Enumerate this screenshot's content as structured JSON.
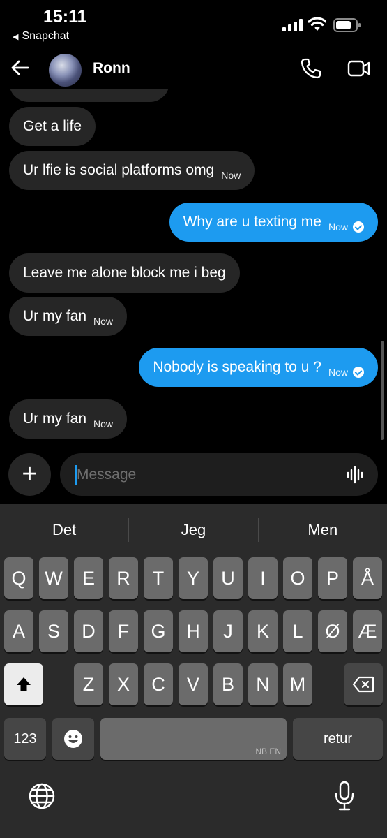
{
  "status_bar": {
    "time": "15:11",
    "back_app": "Snapchat"
  },
  "header": {
    "name": "Ronn",
    "icons": [
      "back-arrow-icon",
      "phone-icon",
      "video-camera-icon"
    ]
  },
  "messages": [
    {
      "side": "in",
      "text": "Get a life",
      "time": ""
    },
    {
      "side": "in",
      "text": "Ur lfie is social platforms omg",
      "time": "Now"
    },
    {
      "side": "out",
      "text": "Why are u texting me",
      "time": "Now"
    },
    {
      "side": "in",
      "text": "Leave me alone block me i beg",
      "time": ""
    },
    {
      "side": "in",
      "text": "Ur my fan",
      "time": "Now"
    },
    {
      "side": "out",
      "text": "Nobody is speaking to u ?",
      "time": "Now"
    },
    {
      "side": "in",
      "text": "Ur my fan",
      "time": "Now"
    }
  ],
  "composer": {
    "placeholder": "Message",
    "plus": "+"
  },
  "keyboard": {
    "suggestions": [
      "Det",
      "Jeg",
      "Men"
    ],
    "row1": [
      "Q",
      "W",
      "E",
      "R",
      "T",
      "Y",
      "U",
      "I",
      "O",
      "P",
      "Å"
    ],
    "row2": [
      "A",
      "S",
      "D",
      "F",
      "G",
      "H",
      "J",
      "K",
      "L",
      "Ø",
      "Æ"
    ],
    "row3": [
      "Z",
      "X",
      "C",
      "V",
      "B",
      "N",
      "M"
    ],
    "numbers_key": "123",
    "return_key": "retur",
    "space_lang": "NB EN"
  },
  "colors": {
    "outgoing": "#1d9bf0",
    "incoming": "#262626",
    "keyboard_bg": "#2b2b2b"
  }
}
